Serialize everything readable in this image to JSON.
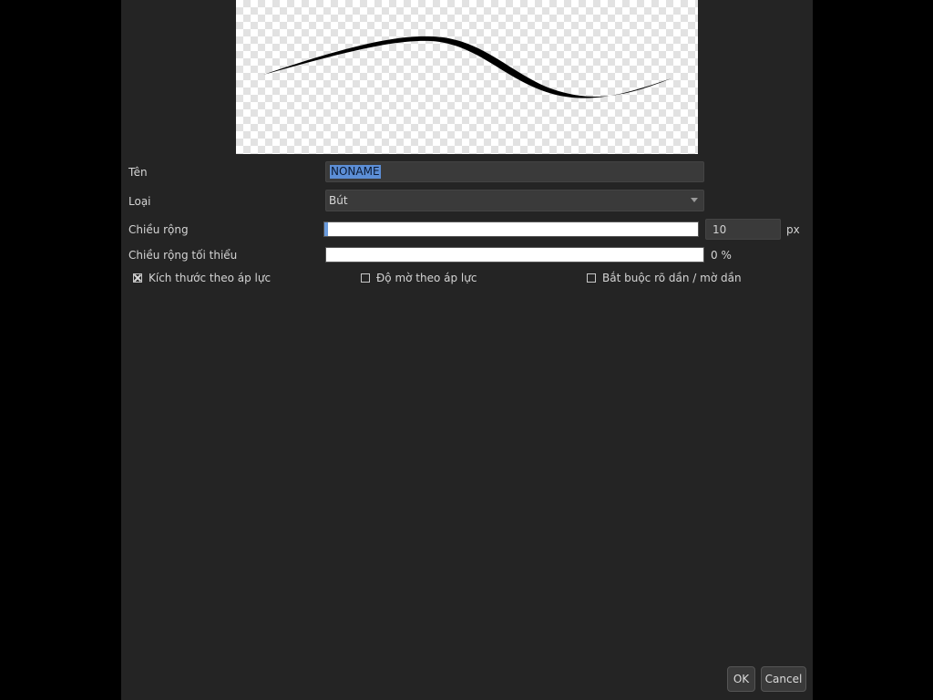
{
  "preview": {
    "stroke_color": "#000000"
  },
  "form": {
    "name_label": "Tên",
    "name_value": "NONAME",
    "type_label": "Loại",
    "type_value": "Bút",
    "width_label": "Chiều rộng",
    "width_value": "10",
    "width_unit": "px",
    "width_slider_fraction": 0.01,
    "min_width_label": "Chiều rộng tối thiểu",
    "min_width_value": "0 %",
    "min_width_slider_fraction": 0
  },
  "options": {
    "size_pressure": {
      "label": "Kích thước theo áp lực",
      "checked": true
    },
    "opacity_pressure": {
      "label": "Độ mờ theo áp lực",
      "checked": false
    },
    "force_fade": {
      "label": "Bắt buộc rõ dần / mờ dần",
      "checked": false
    }
  },
  "buttons": {
    "ok": "OK",
    "cancel": "Cancel"
  },
  "colors": {
    "dialog_bg": "#242424",
    "field_bg": "#3a3a3a",
    "accent": "#5c8ed6"
  }
}
